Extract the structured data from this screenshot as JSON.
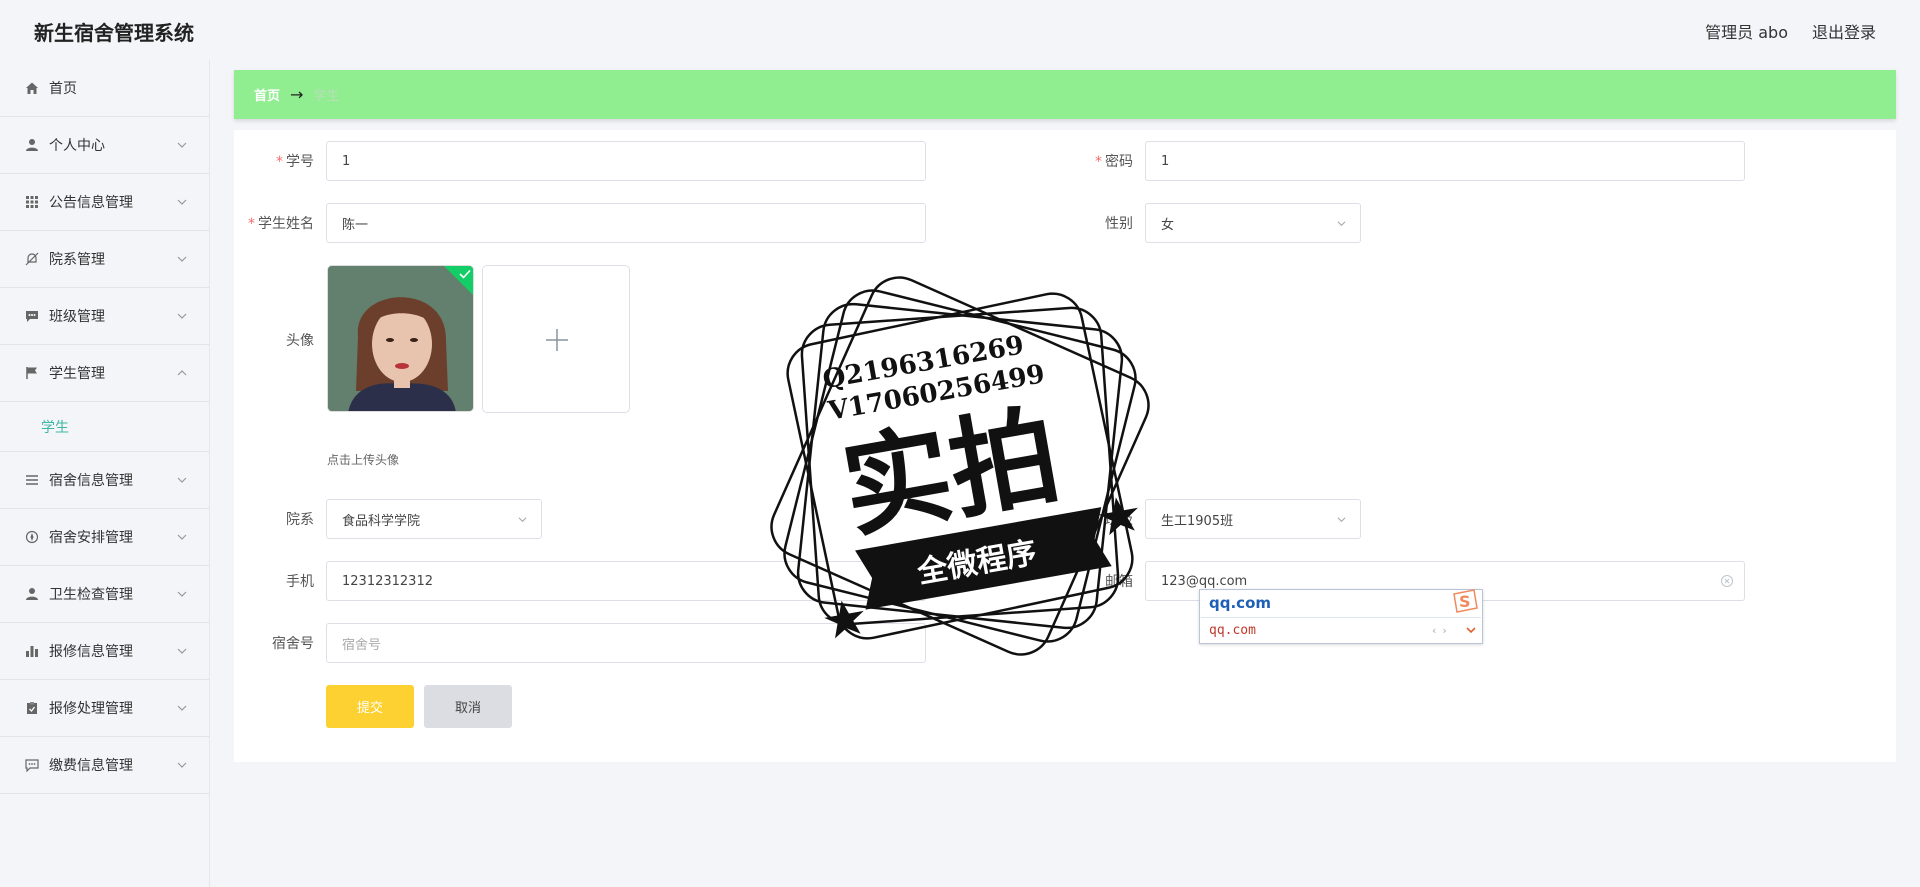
{
  "header": {
    "app_title": "新生宿舍管理系统",
    "user_label": "管理员 abo",
    "logout_label": "退出登录"
  },
  "sidebar": {
    "items": [
      {
        "label": "首页",
        "icon": "home-icon"
      },
      {
        "label": "个人中心",
        "icon": "user-icon"
      },
      {
        "label": "公告信息管理",
        "icon": "grid-icon"
      },
      {
        "label": "院系管理",
        "icon": "bell-off-icon"
      },
      {
        "label": "班级管理",
        "icon": "chat-icon"
      },
      {
        "label": "学生管理",
        "icon": "flag-icon",
        "expanded": true
      },
      {
        "label": "宿舍信息管理",
        "icon": "list-icon"
      },
      {
        "label": "宿舍安排管理",
        "icon": "compass-icon"
      },
      {
        "label": "卫生检查管理",
        "icon": "user-icon"
      },
      {
        "label": "报修信息管理",
        "icon": "bar-chart-icon"
      },
      {
        "label": "报修处理管理",
        "icon": "clipboard-icon"
      },
      {
        "label": "缴费信息管理",
        "icon": "comment-icon"
      }
    ],
    "subitem_student": "学生",
    "active_color": "#3db6a3"
  },
  "breadcrumb": {
    "home": "首页",
    "separator": "→",
    "current": "学生"
  },
  "form": {
    "student_no": {
      "label": "学号",
      "value": "1"
    },
    "password": {
      "label": "密码",
      "value": "1"
    },
    "student_name": {
      "label": "学生姓名",
      "value": "陈一"
    },
    "gender": {
      "label": "性别",
      "value": "女"
    },
    "avatar": {
      "label": "头像",
      "hint": "点击上传头像"
    },
    "department": {
      "label": "院系",
      "value": "食品科学学院"
    },
    "class": {
      "label": "班级",
      "value": "生工1905班"
    },
    "phone": {
      "label": "手机",
      "value": "12312312312"
    },
    "email": {
      "label": "邮箱",
      "value": "123@qq.com"
    },
    "dorm_no": {
      "label": "宿舍号",
      "placeholder": "宿舍号"
    },
    "submit_label": "提交",
    "cancel_label": "取消"
  },
  "ime": {
    "input": "qq.com",
    "candidate": "qq.com"
  },
  "watermark": {
    "line1": "Q2196316269",
    "line2": "V17060256499",
    "big_text": "实拍",
    "ribbon_text": "全微程序"
  },
  "colors": {
    "breadcrumb_bg": "#90ee90",
    "submit_bg": "#fdd131",
    "cancel_bg": "#dcdde2",
    "required": "#f56c6c"
  }
}
